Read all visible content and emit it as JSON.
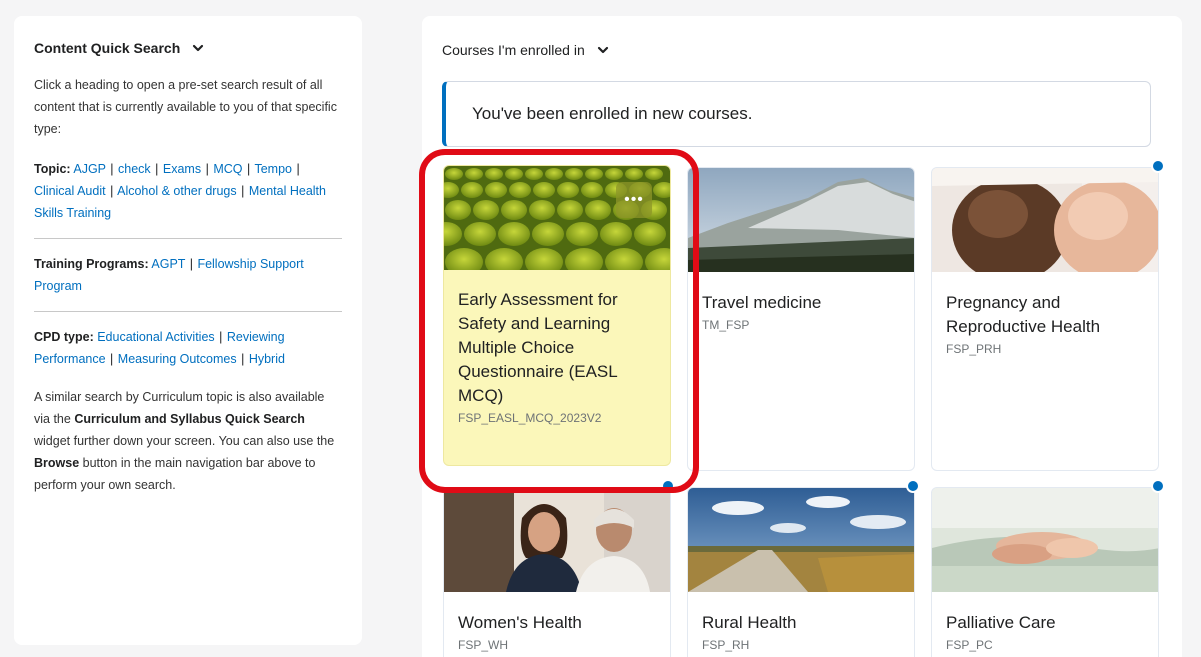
{
  "quick_search": {
    "title": "Content Quick Search",
    "intro": "Click a heading to open a pre-set search result of all content that is currently available to you of that specific type:",
    "topic_label": "Topic:",
    "topic_links": [
      "AJGP",
      "check",
      "Exams",
      "MCQ",
      "Tempo",
      "Clinical Audit",
      "Alcohol & other drugs",
      "Mental Health Skills Training"
    ],
    "training_label": "Training Programs:",
    "training_links": [
      "AGPT",
      "Fellowship Support Program"
    ],
    "cpd_label": "CPD type:",
    "cpd_links": [
      "Educational Activities",
      "Reviewing Performance",
      "Measuring Outcomes",
      "Hybrid"
    ],
    "footer_pre": "A similar search by Curriculum topic is also available via the ",
    "footer_bold1": "Curriculum and Syllabus Quick Search",
    "footer_mid": " widget further down your screen. You can also use the ",
    "footer_bold2": "Browse",
    "footer_post": " button in the main navigation bar above to perform your own search.",
    "separator": "|"
  },
  "courses": {
    "title": "Courses I'm enrolled in",
    "alert": "You've been enrolled in new courses.",
    "accent_color": "#006fbf",
    "highlight_color": "#e00b16",
    "cards": [
      {
        "name": "Early Assessment for Safety and Learning Multiple Choice Questionnaire (EASL MCQ)",
        "code": "FSP_EASL_MCQ_2023V2",
        "image": "green-stadium-seats",
        "new": false,
        "menu": "•••"
      },
      {
        "name": "Travel medicine",
        "code": "TM_FSP",
        "image": "mountain-landscape",
        "new": false
      },
      {
        "name": "Pregnancy and Reproductive Health",
        "code": "FSP_PRH",
        "image": "pregnant-bellies",
        "new": true
      },
      {
        "name": "Women's Health",
        "code": "FSP_WH",
        "image": "doctor-and-patient",
        "new": true
      },
      {
        "name": "Rural Health",
        "code": "FSP_RH",
        "image": "rural-road",
        "new": true
      },
      {
        "name": "Palliative Care",
        "code": "FSP_PC",
        "image": "holding-hands",
        "new": true
      }
    ]
  }
}
